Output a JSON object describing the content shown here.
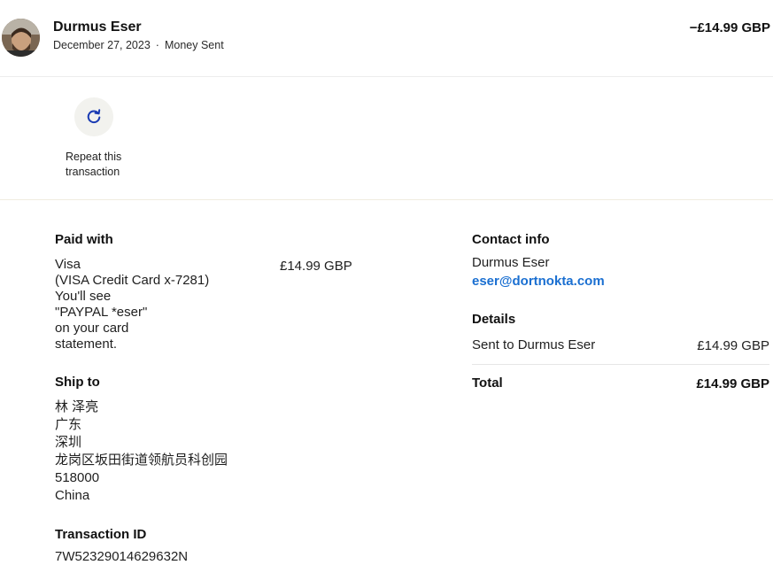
{
  "header": {
    "name": "Durmus Eser",
    "date": "December 27, 2023",
    "separator": "·",
    "type": "Money Sent",
    "amount": "−£14.99 GBP"
  },
  "actions": {
    "repeat_label": "Repeat this transaction",
    "icon": "refresh-icon"
  },
  "paid_with": {
    "heading": "Paid with",
    "lines": [
      "Visa",
      "(VISA Credit Card x-7281)",
      "You'll see",
      "\"PAYPAL *eser\"",
      "on your card",
      "statement."
    ],
    "amount": "£14.99 GBP"
  },
  "ship_to": {
    "heading": "Ship to",
    "lines": [
      "林 泽亮",
      "广东",
      "深圳",
      "龙岗区坂田街道领航员科创园",
      "518000",
      "China"
    ]
  },
  "transaction": {
    "heading": "Transaction ID",
    "id": "7W52329014629632N"
  },
  "contact": {
    "heading": "Contact info",
    "name": "Durmus Eser",
    "email": "eser@dortnokta.com"
  },
  "details": {
    "heading": "Details",
    "sent_label": "Sent to Durmus Eser",
    "sent_amount": "£14.99 GBP",
    "total_label": "Total",
    "total_amount": "£14.99 GBP"
  },
  "colors": {
    "link": "#1a6fd1",
    "icon": "#1a3bb3",
    "icon_bg": "#f2f2ee"
  }
}
